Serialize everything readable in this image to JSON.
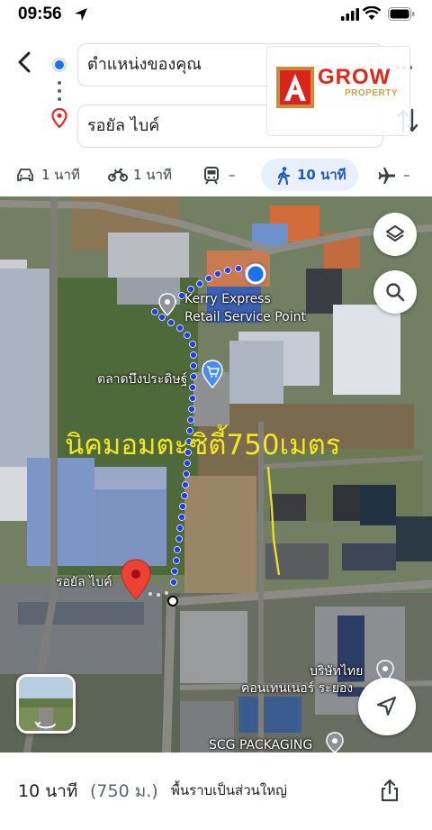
{
  "status_bar": {
    "time": "09:56"
  },
  "route": {
    "origin_value": "ตำแหน่งของคุณ",
    "destination_value": "รอยัล ไบค์"
  },
  "watermark": {
    "brand": "GROW",
    "brand_prefix": "A",
    "subtitle": "PROPERTY"
  },
  "modes": [
    {
      "name": "car",
      "label": "1 นาที"
    },
    {
      "name": "motorcycle",
      "label": "1 นาที"
    },
    {
      "name": "transit",
      "label": "–"
    },
    {
      "name": "walk",
      "label": "10 นาที",
      "selected": true
    },
    {
      "name": "flight",
      "label": "–"
    }
  ],
  "map": {
    "labels": {
      "kerry_line1": "Kerry Express",
      "kerry_line2": "Retail Service Point",
      "market": "ตลาดบึงประดิษฐ์",
      "destination": "รอยัล ไบค์",
      "company_line1": "บริษัทไทย",
      "company_line2": "คอนเทนเนอร์ ระยอง",
      "scg": "SCG PACKAGING"
    },
    "annotation": "นิคมอมตะซิตี้750เมตร",
    "icons": [
      "layers-icon",
      "search-icon",
      "navigation-arrow-icon",
      "rotate-icon",
      "shopping-cart-icon",
      "place-pin-icon"
    ]
  },
  "summary": {
    "duration": "10 นาที",
    "distance": "(750 ม.)",
    "description": "พื้นราบเป็นส่วนใหญ่"
  },
  "colors": {
    "accent": "#1a73e8",
    "route_dots": "#1f3cff",
    "destination_pin": "#ea4335",
    "annotation": "#f0e62a",
    "selected_mode_bg": "#e8f0fe"
  }
}
